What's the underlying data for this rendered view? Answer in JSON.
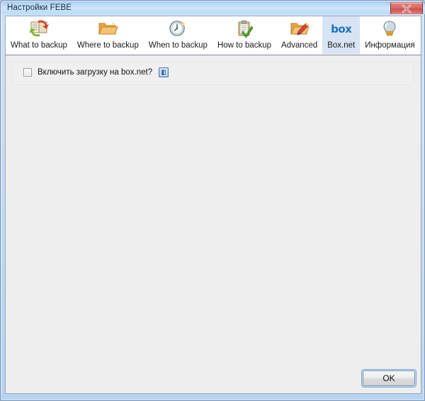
{
  "window": {
    "title": "Настройки FEBE",
    "close_label": "Close",
    "close_icon": "close-x-icon"
  },
  "tabs": [
    {
      "label": "What to backup",
      "icon": "book-with-arrows-icon",
      "selected": false
    },
    {
      "label": "Where to backup",
      "icon": "folder-icon",
      "selected": false
    },
    {
      "label": "When to backup",
      "icon": "clock-icon",
      "selected": false
    },
    {
      "label": "How to backup",
      "icon": "clipboard-check-icon",
      "selected": false
    },
    {
      "label": "Advanced",
      "icon": "folder-pencil-icon",
      "selected": false
    },
    {
      "label": "Box.net",
      "icon": "box-logo-icon",
      "selected": true,
      "logo_text": "box"
    },
    {
      "label": "Информация",
      "icon": "lightbulb-icon",
      "selected": false
    }
  ],
  "content": {
    "checkbox": {
      "label": "Включить загрузку на box.net?",
      "checked": false
    },
    "info_button": {
      "icon": "info-icon",
      "glyph": "i"
    }
  },
  "footer": {
    "ok_label": "OK"
  },
  "colors": {
    "titlebar_blue": "#bcddfa",
    "selected_tab": "#d8e3f3",
    "client_bg": "#efeeee",
    "box_blue": "#1b72c0",
    "close_red": "#cf514c",
    "focus_ring": "#6fa8dc"
  }
}
